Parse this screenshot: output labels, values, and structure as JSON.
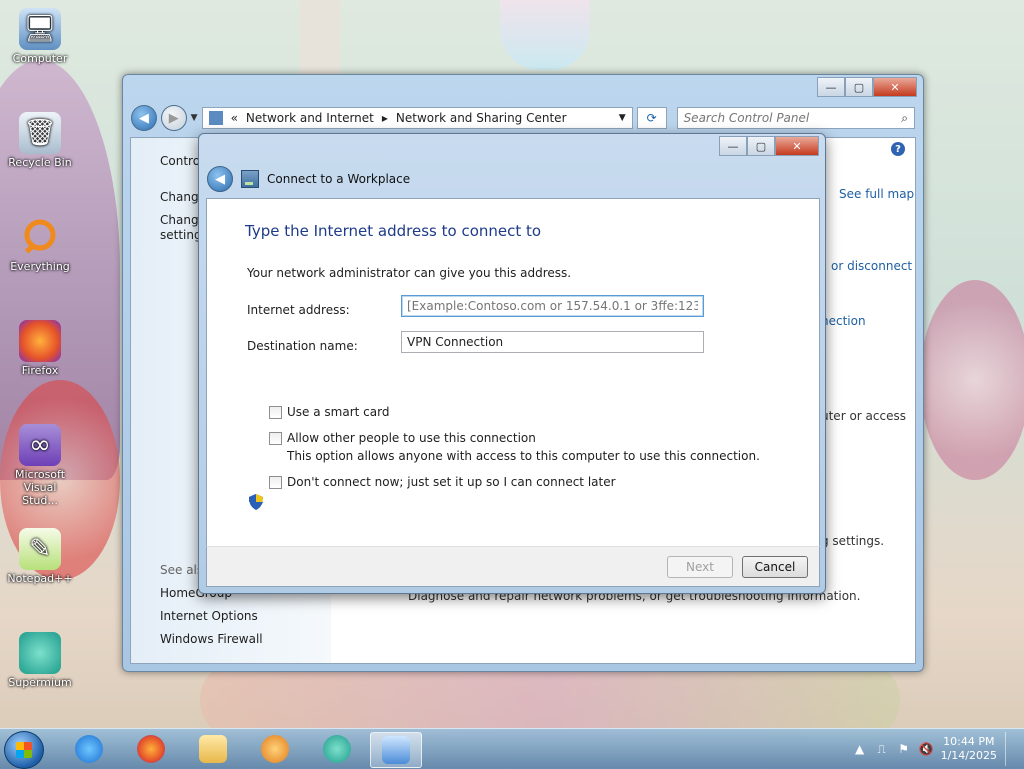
{
  "desktop": {
    "icons": [
      {
        "label": "Computer"
      },
      {
        "label": "Recycle Bin"
      },
      {
        "label": "Everything"
      },
      {
        "label": "Firefox"
      },
      {
        "label": "Microsoft Visual Stud..."
      },
      {
        "label": "Notepad++"
      },
      {
        "label": "Supermium"
      }
    ]
  },
  "background_window": {
    "breadcrumb": {
      "prefix": "«",
      "part1": "Network and Internet",
      "part2": "Network and Sharing Center"
    },
    "search_placeholder": "Search Control Panel",
    "sidebar": {
      "control_panel": "Control",
      "change1": "Change",
      "change2": "Change",
      "settings": "settings",
      "see_also": "See also",
      "links": [
        "HomeGroup",
        "Internet Options",
        "Windows Firewall"
      ]
    },
    "right_links": {
      "see_full_map": "See full map",
      "or_disconnect": "or disconnect",
      "nection": "nection",
      "uter_or_access": "uter or access",
      "g_settings": "g settings.",
      "diagnose": "Diagnose and repair network problems, or get troubleshooting information."
    }
  },
  "dialog": {
    "title": "Connect to a Workplace",
    "heading": "Type the Internet address to connect to",
    "intro": "Your network administrator can give you this address.",
    "internet_address_label": "Internet address:",
    "internet_address_placeholder": "[Example:Contoso.com or 157.54.0.1 or 3ffe:1234::1111]",
    "destination_label": "Destination name:",
    "destination_value": "VPN Connection",
    "checkboxes": {
      "smart_card": "Use a smart card",
      "allow_others": "Allow other people to use this connection",
      "allow_others_desc": "This option allows anyone with access to this computer to use this connection.",
      "dont_connect": "Don't connect now; just set it up so I can connect later"
    },
    "buttons": {
      "next": "Next",
      "cancel": "Cancel"
    }
  },
  "taskbar": {
    "time": "10:44 PM",
    "date": "1/14/2025"
  }
}
